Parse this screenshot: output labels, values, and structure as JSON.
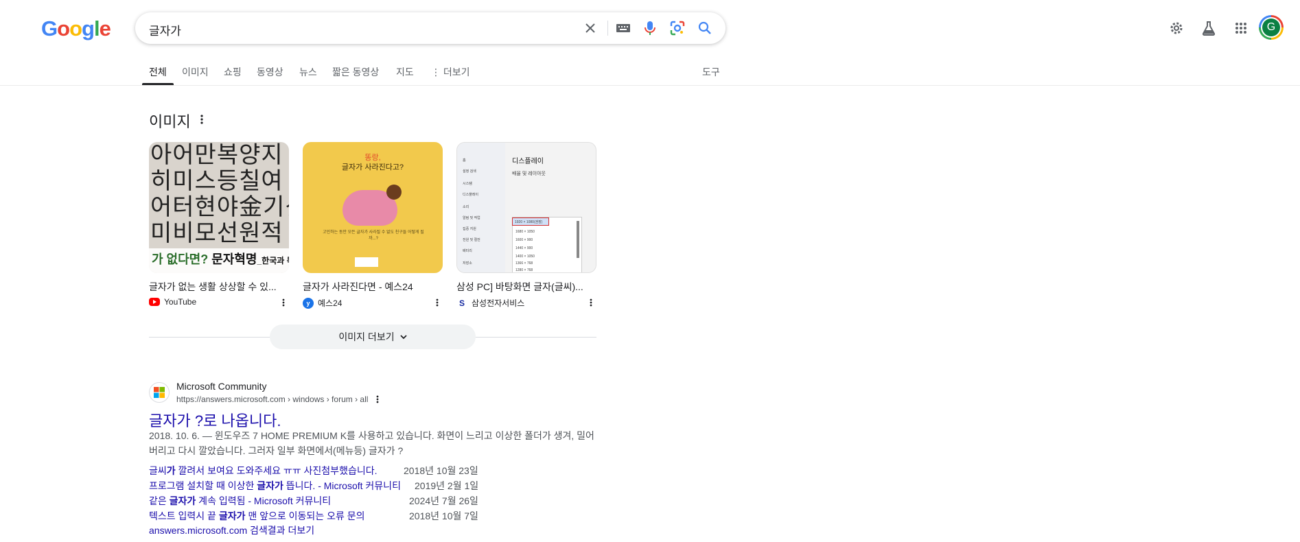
{
  "logo": {
    "letters": [
      "G",
      "o",
      "o",
      "g",
      "l",
      "e"
    ],
    "colors": [
      "#4285f4",
      "#ea4335",
      "#fbbc05",
      "#4285f4",
      "#34a853",
      "#ea4335"
    ]
  },
  "search": {
    "query": "글자가"
  },
  "header": {
    "avatar_letter": "G"
  },
  "tabs": [
    "전체",
    "이미지",
    "쇼핑",
    "동영상",
    "뉴스",
    "짧은 동영상",
    "지도",
    "⋮ 더보기"
  ],
  "tools_label": "도구",
  "images_section": {
    "title": "이미지",
    "cards": [
      {
        "caption": "글자가 없는 생활 상상할 수 있...",
        "source": "YouTube",
        "thumb_chars": "아어만복양지\n히미스등칠여\n어터현야金기섯\n미비모선원적",
        "thumb_band": [
          "가 없다면? ",
          "문자혁명",
          "_한국과 독일"
        ]
      },
      {
        "caption": "글자가 사라진다면 - 예스24",
        "source": "예스24",
        "thumb_title": [
          "똥랑,",
          "글자가 사라진다고?"
        ],
        "thumb_text": "고민하는 동안 모든 글자가 사라질 수 없도 친구들 어떻게 될까...?"
      },
      {
        "caption": "삼성 PC] 바탕화면 글자(글씨)...",
        "source": "삼성전자서비스",
        "thumb_heading": "디스플레이",
        "thumb_sub": "배율 및 레이아웃",
        "thumb_selected": "1920 × 1080(권장)",
        "thumb_sidebar": [
          "홈",
          "설정 검색",
          "시스템",
          "디스플레이",
          "소리",
          "알림 및 작업",
          "집중 지원",
          "전원 및 절전",
          "배터리",
          "저장소"
        ],
        "thumb_options": [
          "1680 × 1050",
          "1600 × 900",
          "1440 × 900",
          "1400 × 1050",
          "1366 × 768",
          "1280 × 768"
        ]
      }
    ],
    "more_button": "이미지 더보기"
  },
  "result": {
    "site_name": "Microsoft Community",
    "site_url": "https://answers.microsoft.com › windows › forum › all",
    "title": "글자가 ?로 나옵니다.",
    "snippet": "2018. 10. 6. — 윈도우즈 7 HOME PREMIUM K를 사용하고 있습니다. 화면이 느리고 이상한 폴더가 생겨, 밀어 버리고 다시 깔았습니다. 그러자 일부 화면에서(메뉴등) 글자가 ?",
    "sublinks": [
      {
        "pre": "글씨",
        "bold": "가",
        "post": " 깔려서 보여요 도와주세요 ㅠㅠ 사진첨부했습니다.",
        "date": "2018년 10월 23일"
      },
      {
        "pre": "프로그램 설치할 때 이상한 ",
        "bold": "글자가",
        "post": " 뜹니다. - Microsoft 커뮤니티",
        "date": "2019년 2월 1일"
      },
      {
        "pre": "같은 ",
        "bold": "글자가",
        "post": " 계속 입력됨 - Microsoft 커뮤니티",
        "date": "2024년 7월 26일"
      },
      {
        "pre": "텍스트 입력시 끝 ",
        "bold": "글자가",
        "post": " 맨 앞으로 이동되는 오류 문의",
        "date": "2018년 10월 7일"
      }
    ],
    "more_results": "answers.microsoft.com 검색결과 더보기"
  }
}
